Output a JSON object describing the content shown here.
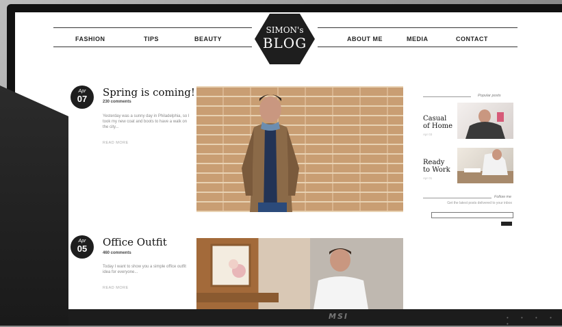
{
  "nav": {
    "left": [
      "FASHION",
      "TIPS",
      "BEAUTY"
    ],
    "right": [
      "ABOUT ME",
      "MEDIA",
      "CONTACT"
    ]
  },
  "logo": {
    "line1": "SIMON's",
    "line2": "BLOG"
  },
  "posts": [
    {
      "month": "Apr",
      "day": "07",
      "title": "Spring is coming!",
      "comments": "230 comments",
      "excerpt": "Yesterday was a sunny day in Philadelphia, so I took my new coat and boots to have a walk on the city...",
      "read_more": "READ MORE"
    },
    {
      "month": "Apr",
      "day": "05",
      "title": "Office Outfit",
      "comments": "460 comments",
      "excerpt": "Today I want to show you a simple office outfit idea for everyone...",
      "read_more": "READ MORE"
    }
  ],
  "sidebar": {
    "popular_heading": "Popular posts",
    "popular": [
      {
        "title_line1": "Casual",
        "title_line2": "of Home",
        "sub": "Apr 03"
      },
      {
        "title_line1": "Ready",
        "title_line2": "to Work",
        "sub": "Apr 01"
      }
    ],
    "follow_heading": "Follow me",
    "follow_text": "Get the latest posts delivered to your inbox"
  },
  "monitor_brand": "MSI"
}
